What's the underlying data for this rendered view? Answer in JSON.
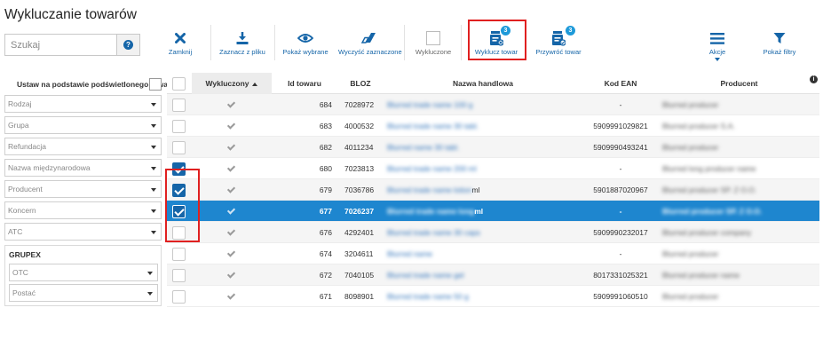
{
  "title": "Wykluczanie towarów",
  "search": {
    "placeholder": "Szukaj",
    "help_glyph": "?"
  },
  "toolbar": {
    "close": "Zamknij",
    "mark_from_file": "Zaznacz z pliku",
    "show_selected": "Pokaż wybrane",
    "clear_selected": "Wyczyść zaznaczone",
    "excluded": "Wykluczone",
    "exclude_product": "Wyklucz towar",
    "exclude_badge": "3",
    "restore_product": "Przywróć towar",
    "restore_badge": "3",
    "actions": "Akcje",
    "show_filters": "Pokaż filtry"
  },
  "filters": {
    "title": "Ustaw na podstawie podświetlonego towaru",
    "rodzaj": "Rodzaj",
    "grupa": "Grupa",
    "refundacja": "Refundacja",
    "nazwa_miedzynarodowa": "Nazwa międzynarodowa",
    "producent": "Producent",
    "koncern": "Koncern",
    "atc": "ATC",
    "grupex": {
      "title": "GRUPEX",
      "otc": "OTC",
      "postac": "Postać"
    }
  },
  "table": {
    "headers": {
      "excluded": "Wykluczony",
      "id": "Id towaru",
      "bloz": "BLOZ",
      "name": "Nazwa handlowa",
      "ean": "Kod EAN",
      "producer": "Producent",
      "info": "i"
    },
    "rows": [
      {
        "id": "684",
        "bloz": "7028972",
        "name": "Blurred trade name 100 g",
        "ean": "-",
        "producer": "Blurred producer",
        "checked": false
      },
      {
        "id": "683",
        "bloz": "4000532",
        "name": "Blurred trade name 30 tabl.",
        "ean": "5909991029821",
        "producer": "Blurred producer S.A.",
        "checked": false
      },
      {
        "id": "682",
        "bloz": "4011234",
        "name": "Blurred name 30 tabl.",
        "ean": "5909990493241",
        "producer": "Blurred producer",
        "checked": false
      },
      {
        "id": "680",
        "bloz": "7023813",
        "name": "Blurred trade name 200 ml",
        "ean": "-",
        "producer": "Blurred long producer name",
        "checked": true
      },
      {
        "id": "679",
        "bloz": "7036786",
        "name": "Blurred trade name lotion",
        "name_suffix": "ml",
        "ean": "5901887020967",
        "producer": "Blurred producer SP. Z O.O.",
        "checked": true
      },
      {
        "id": "677",
        "bloz": "7026237",
        "name": "Blurred trade name long",
        "name_suffix": "ml",
        "ean": "-",
        "producer": "Blurred producer SP. Z O.O.",
        "checked": true
      },
      {
        "id": "676",
        "bloz": "4292401",
        "name": "Blurred trade name 30 caps",
        "ean": "5909990232017",
        "producer": "Blurred producer company",
        "checked": false
      },
      {
        "id": "674",
        "bloz": "3204611",
        "name": "Blurred name",
        "ean": "-",
        "producer": "Blurred producer",
        "checked": false
      },
      {
        "id": "672",
        "bloz": "7040105",
        "name": "Blurred trade name gel",
        "ean": "8017331025321",
        "producer": "Blurred producer name",
        "checked": false
      },
      {
        "id": "671",
        "bloz": "8098901",
        "name": "Blurred trade name 50 g",
        "ean": "5909991060510",
        "producer": "Blurred producer",
        "checked": false
      }
    ]
  },
  "colors": {
    "accent": "#1565a8",
    "selected_row": "#1e86cf",
    "badge": "#1e9ad9",
    "highlight": "#e02020"
  }
}
